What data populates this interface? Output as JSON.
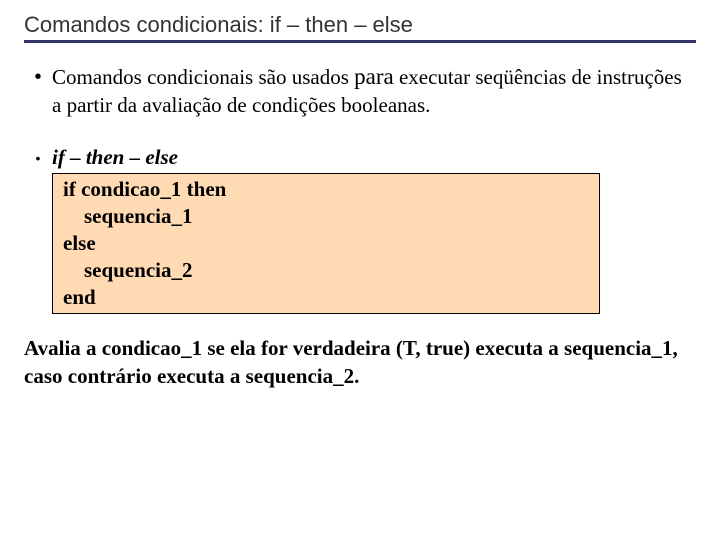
{
  "title": "Comandos condicionais: if – then – else",
  "bullet1": {
    "pre": "Comandos condicionais são usados ",
    "emph": "para",
    "post": " executar seqüências de instruções a partir da avaliação de condições booleanas."
  },
  "bullet2": {
    "label": "if – then – else",
    "code": {
      "l1": "if condicao_1 then",
      "l2": "    sequencia_1",
      "l3": "else",
      "l4": "    sequencia_2",
      "l5": "end"
    }
  },
  "footer": "Avalia a condicao_1 se ela for verdadeira (T, true) executa a sequencia_1, caso contrário executa a sequencia_2."
}
